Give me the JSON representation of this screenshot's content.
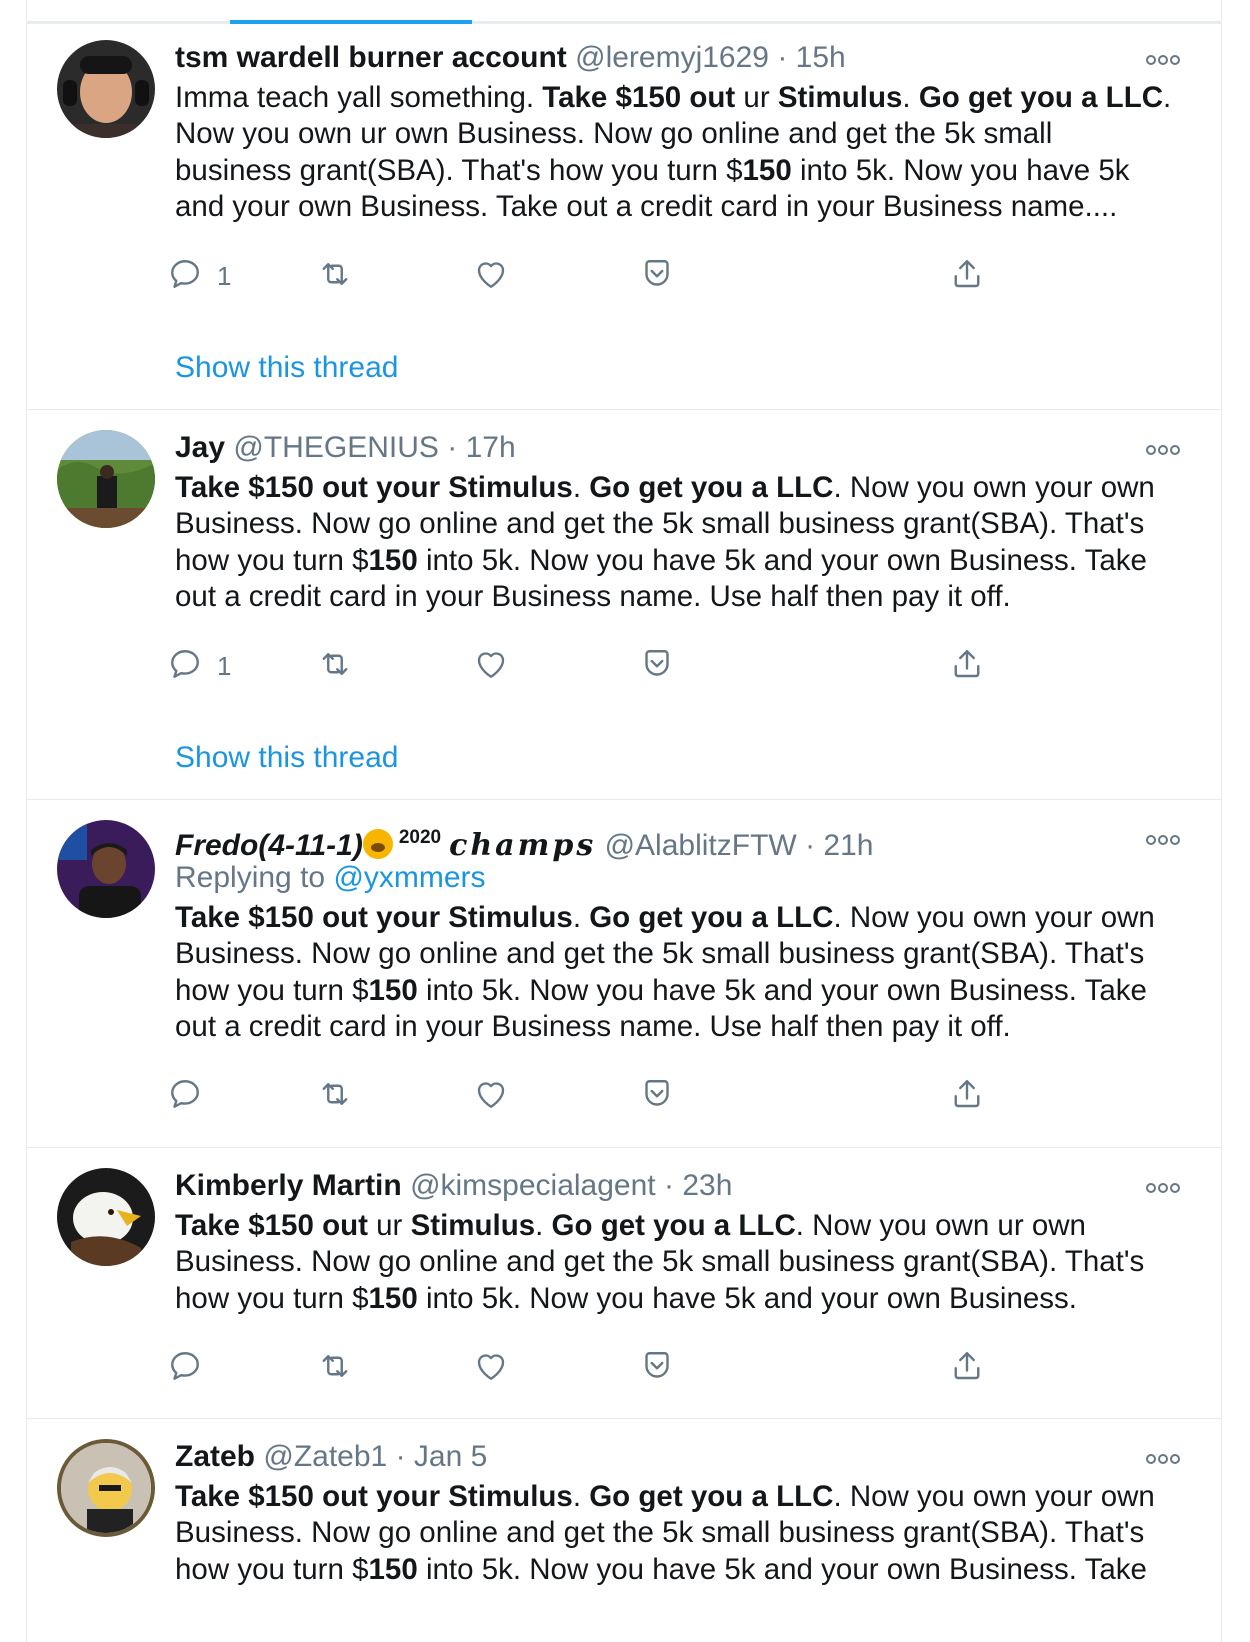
{
  "colors": {
    "accent": "#1da1f2",
    "link": "#1b95e0",
    "muted": "#657786",
    "text": "#14171a",
    "divider": "#e6ecf0"
  },
  "icons": {
    "reply": "reply-icon",
    "retweet": "retweet-icon",
    "like": "heart-icon",
    "bookmark": "bookmark-icon",
    "share": "share-icon",
    "more": "more-icon"
  },
  "tweets": [
    {
      "name": "tsm wardell burner account",
      "handle": "@leremyj1629",
      "sep": "·",
      "time": "15h",
      "body_segments": [
        {
          "t": "Imma teach yall something. ",
          "b": false
        },
        {
          "t": "Take $150 out",
          "b": true
        },
        {
          "t": " ur ",
          "b": false
        },
        {
          "t": "Stimulus",
          "b": true
        },
        {
          "t": ". ",
          "b": false
        },
        {
          "t": "Go get you a LLC",
          "b": true
        },
        {
          "t": ". Now you own ur own Business. Now go online and  get the 5k small business grant(SBA). That's how you turn $",
          "b": false
        },
        {
          "t": "150",
          "b": true
        },
        {
          "t": " into 5k. Now you have 5k and your own Business. Take out a credit card in your Business name....",
          "b": false
        }
      ],
      "reply_count": "1",
      "show_thread": "Show this thread"
    },
    {
      "name": "Jay",
      "handle": "@THEGENIUS",
      "sep": "·",
      "time": "17h",
      "body_segments": [
        {
          "t": "Take $150 out your Stimulus",
          "b": true
        },
        {
          "t": ". ",
          "b": false
        },
        {
          "t": "Go get you a LLC",
          "b": true
        },
        {
          "t": ". Now you own your own Business. Now go online and get the 5k small business grant(SBA). That's how you turn $",
          "b": false
        },
        {
          "t": "150",
          "b": true
        },
        {
          "t": " into 5k. Now you have 5k and your own Business. Take out a credit card in your Business name. Use half then pay it off.",
          "b": false
        }
      ],
      "reply_count": "1",
      "show_thread": "Show this thread"
    },
    {
      "name": "Fredo(4-11-1)",
      "name_sup": "2020",
      "name_script": "champs",
      "handle": "@AlablitzFTW",
      "sep": "·",
      "time": "21h",
      "replying_prefix": "Replying to ",
      "replying_mention": "@yxmmers",
      "body_segments": [
        {
          "t": "Take $150 out your Stimulus",
          "b": true
        },
        {
          "t": ". ",
          "b": false
        },
        {
          "t": "Go get you a LLC",
          "b": true
        },
        {
          "t": ". Now you own your own Business. Now go online and get the 5k small business grant(SBA). That's how you turn $",
          "b": false
        },
        {
          "t": "150",
          "b": true
        },
        {
          "t": " into 5k. Now you have 5k and your own Business. Take out a credit card in your Business name. Use half then pay it off.",
          "b": false
        }
      ]
    },
    {
      "name": "Kimberly Martin",
      "handle": "@kimspecialagent",
      "sep": "·",
      "time": "23h",
      "body_segments": [
        {
          "t": "Take $150 out",
          "b": true
        },
        {
          "t": " ur ",
          "b": false
        },
        {
          "t": "Stimulus",
          "b": true
        },
        {
          "t": ". ",
          "b": false
        },
        {
          "t": "Go get you a LLC",
          "b": true
        },
        {
          "t": ". Now you own ur own Business. Now go online and  get the 5k small business grant(SBA). That's how you turn $",
          "b": false
        },
        {
          "t": "150",
          "b": true
        },
        {
          "t": " into 5k. Now you have 5k and your own Business.",
          "b": false
        }
      ]
    },
    {
      "name": "Zateb",
      "handle": "@Zateb1",
      "sep": "·",
      "time": "Jan 5",
      "body_segments": [
        {
          "t": "Take $150 out your Stimulus",
          "b": true
        },
        {
          "t": ". ",
          "b": false
        },
        {
          "t": "Go get you a LLC",
          "b": true
        },
        {
          "t": ". Now you own your own Business. Now go online and get the 5k small business grant(SBA). That's how you turn $",
          "b": false
        },
        {
          "t": "150",
          "b": true
        },
        {
          "t": " into 5k. Now you have 5k and your own Business. Take",
          "b": false
        }
      ]
    }
  ]
}
